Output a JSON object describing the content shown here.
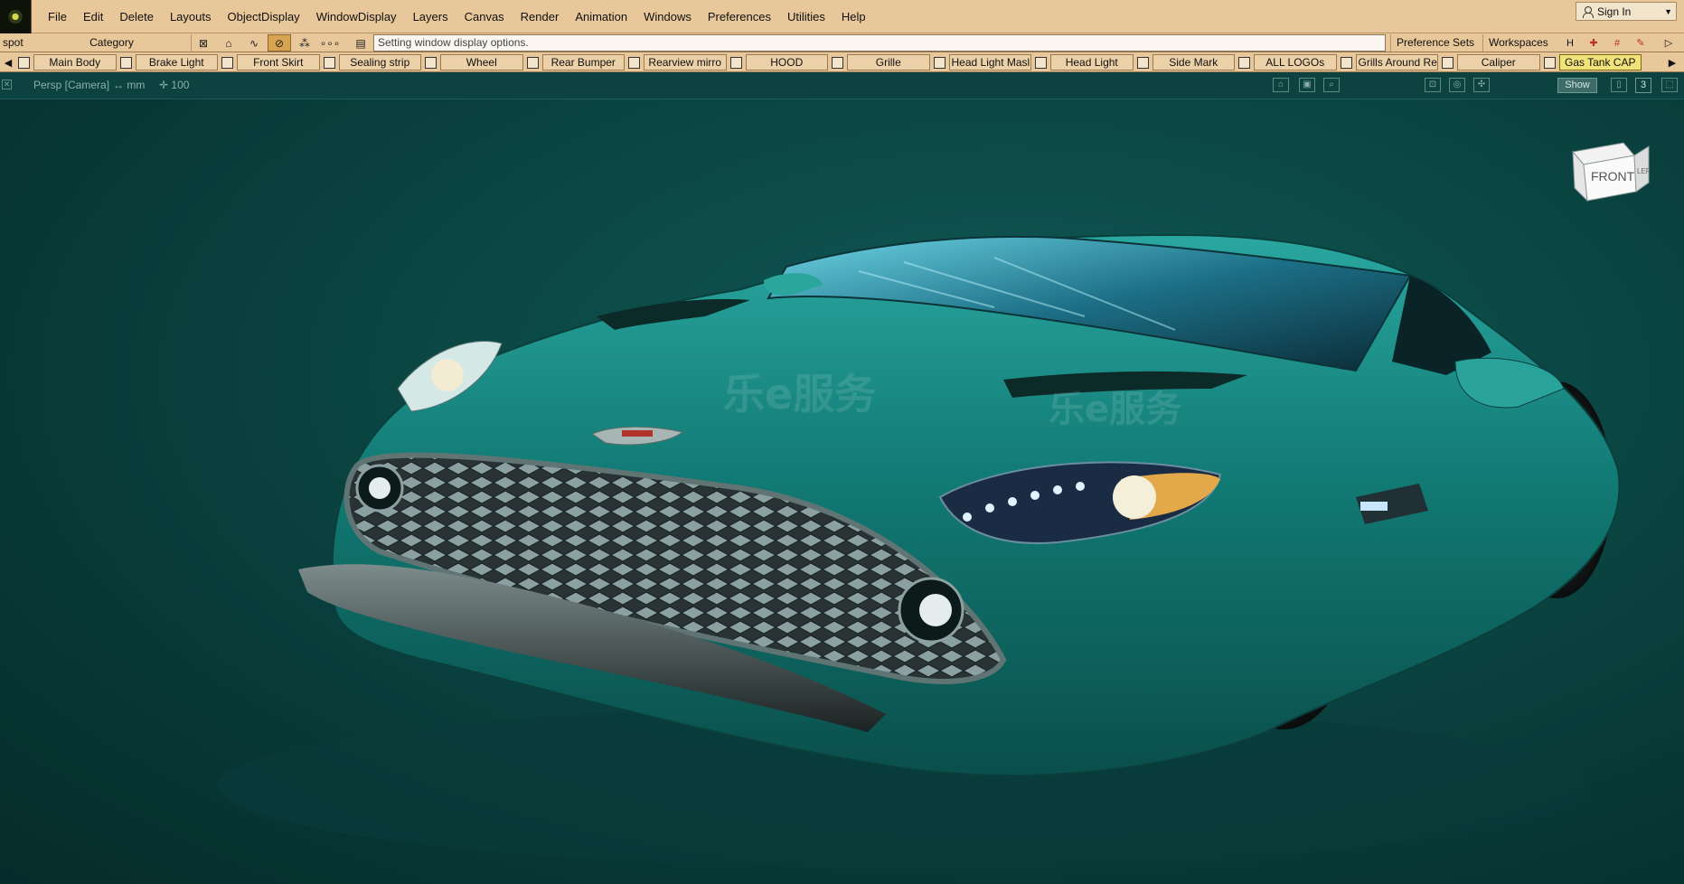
{
  "menubar": {
    "items": [
      "File",
      "Edit",
      "Delete",
      "Layouts",
      "ObjectDisplay",
      "WindowDisplay",
      "Layers",
      "Canvas",
      "Render",
      "Animation",
      "Windows",
      "Preferences",
      "Utilities",
      "Help"
    ],
    "sign_in": "Sign In"
  },
  "toolbar": {
    "shelf_name": "spot",
    "category": "Category",
    "status_text": "Setting window display options.",
    "preference_sets": "Preference Sets",
    "workspaces": "Workspaces"
  },
  "layers": [
    {
      "label": "Main Body",
      "active": false
    },
    {
      "label": "Brake Light",
      "active": false
    },
    {
      "label": "Front Skirt",
      "active": false
    },
    {
      "label": "Sealing strip",
      "active": false
    },
    {
      "label": "Wheel",
      "active": false
    },
    {
      "label": "Rear Bumper",
      "active": false
    },
    {
      "label": "Rearview mirro",
      "active": false
    },
    {
      "label": "HOOD",
      "active": false
    },
    {
      "label": "Grille",
      "active": false
    },
    {
      "label": "Head Light Masl",
      "active": false
    },
    {
      "label": "Head Light",
      "active": false
    },
    {
      "label": "Side Mark",
      "active": false
    },
    {
      "label": "ALL LOGOs",
      "active": false
    },
    {
      "label": "Grills Around Re",
      "active": false
    },
    {
      "label": "Caliper",
      "active": false
    },
    {
      "label": "Gas Tank CAP",
      "active": true
    }
  ],
  "viewport": {
    "camera": "Persp [Camera]",
    "units": "mm",
    "scale": "100",
    "show_button": "Show",
    "window_number": "3",
    "viewcube_front": "FRONT",
    "viewcube_left": "LEFT",
    "watermark": "乐e服务"
  },
  "colors": {
    "ui_tan": "#e8c79a",
    "viewport_bg": "#0b4744",
    "car_body": "#13807a",
    "active_layer": "#f2e27a"
  }
}
